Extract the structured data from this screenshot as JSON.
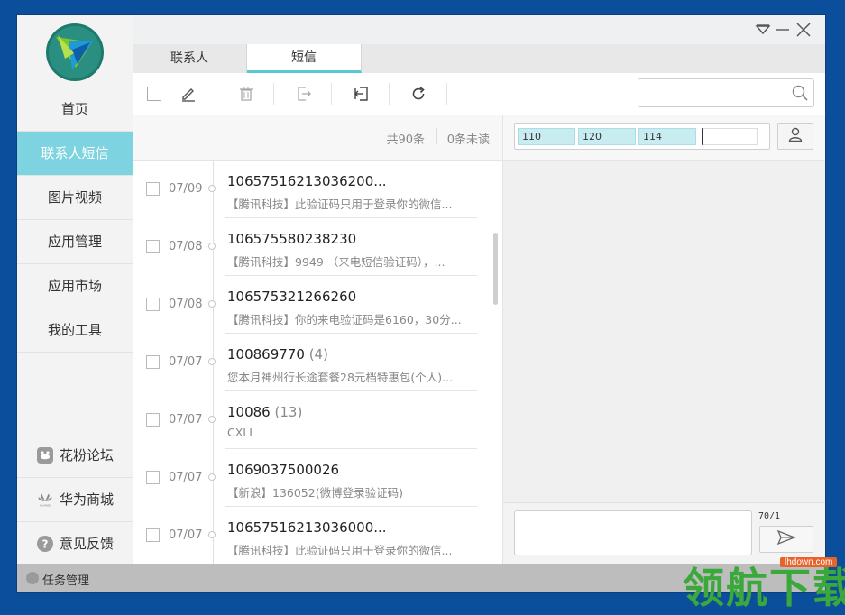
{
  "window": {
    "accent": "#7dd3df",
    "tab_accent": "#56c8d6"
  },
  "sidebar": {
    "items": [
      {
        "label": "首页"
      },
      {
        "label": "联系人短信",
        "active": true
      },
      {
        "label": "图片视频"
      },
      {
        "label": "应用管理"
      },
      {
        "label": "应用市场"
      },
      {
        "label": "我的工具"
      }
    ],
    "bottom_items": [
      {
        "label": "花粉论坛",
        "icon": "forum-icon"
      },
      {
        "label": "华为商城",
        "icon": "huawei-logo-icon",
        "icon_text": "HUAWEI"
      },
      {
        "label": "意见反馈",
        "icon": "help-icon",
        "icon_text": "?"
      }
    ]
  },
  "tabs": [
    {
      "label": "联系人"
    },
    {
      "label": "短信",
      "active": true
    }
  ],
  "toolbar": {
    "icons": [
      "checkbox-icon",
      "compose-icon",
      "delete-icon",
      "export-icon",
      "import-icon",
      "refresh-icon"
    ],
    "search_placeholder": ""
  },
  "list_header": {
    "total": "共90条",
    "unread": "0条未读"
  },
  "messages": [
    {
      "date": "07/09",
      "sender": "10657516213036200...",
      "count": "",
      "preview": "【腾讯科技】此验证码只用于登录你的微信..."
    },
    {
      "date": "07/08",
      "sender": "106575580238230",
      "count": "",
      "preview": "【腾讯科技】9949 （来电短信验证码），..."
    },
    {
      "date": "07/08",
      "sender": "106575321266260",
      "count": "",
      "preview": "【腾讯科技】你的来电验证码是6160，30分..."
    },
    {
      "date": "07/07",
      "sender": "100869770",
      "count": "(4)",
      "preview": "您本月神州行长途套餐28元档特惠包(个人)..."
    },
    {
      "date": "07/07",
      "sender": "10086",
      "count": "(13)",
      "preview": "CXLL"
    },
    {
      "date": "07/07",
      "sender": "1069037500026",
      "count": "",
      "preview": "【新浪】136052(微博登录验证码)"
    },
    {
      "date": "07/07",
      "sender": "10657516213036000...",
      "count": "",
      "preview": "【腾讯科技】此验证码只用于登录你的微信..."
    }
  ],
  "recipients": [
    "110",
    "120",
    "114"
  ],
  "compose": {
    "char_count": "70/1",
    "placeholder": ""
  },
  "statusbar": {
    "task_label": "任务管理"
  },
  "watermark": {
    "text": "领航下载",
    "tag": "lhdown.com"
  }
}
